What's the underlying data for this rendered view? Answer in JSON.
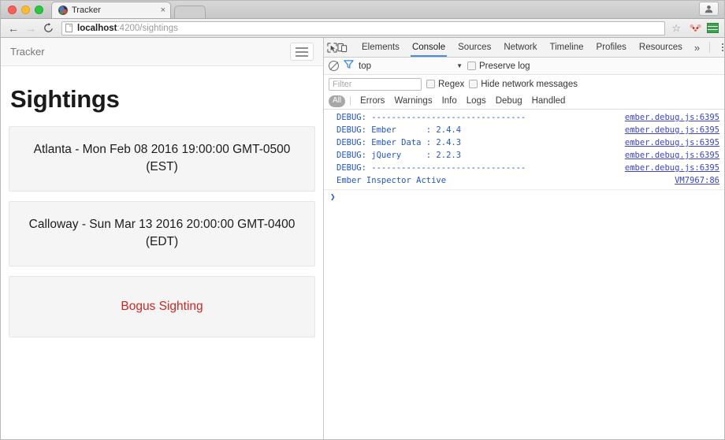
{
  "browser": {
    "traffic_lights": [
      "close",
      "minimize",
      "zoom"
    ],
    "tab": {
      "title": "Tracker",
      "close_label": "×",
      "favicon": "globe-favicon"
    },
    "toolbar": {
      "back_label": "←",
      "forward_label": "→",
      "reload_label": "↻",
      "url_host": "localhost",
      "url_rest": ":4200/sightings",
      "url_full": "localhost:4200/sightings",
      "bookmark_label": "☆",
      "profile_icon": "person-icon",
      "extension_icon": "ember-extension-icon",
      "menu_extension_icon": "green-lines-extension-icon"
    }
  },
  "app": {
    "brand": "Tracker",
    "nav_toggle": "hamburger-menu",
    "page_title": "Sightings",
    "sightings": [
      {
        "text": "Atlanta - Mon Feb 08 2016 19:00:00 GMT-0500 (EST)",
        "bogus": false
      },
      {
        "text": "Calloway - Sun Mar 13 2016 20:00:00 GMT-0400 (EDT)",
        "bogus": false
      },
      {
        "text": "Bogus Sighting",
        "bogus": true
      }
    ],
    "bogus_color": "#cf2620"
  },
  "devtools": {
    "toolbar_icons": [
      "inspect-element-icon",
      "device-toolbar-icon"
    ],
    "tabs": [
      {
        "label": "Elements",
        "active": false
      },
      {
        "label": "Console",
        "active": true
      },
      {
        "label": "Sources",
        "active": false
      },
      {
        "label": "Network",
        "active": false
      },
      {
        "label": "Timeline",
        "active": false
      },
      {
        "label": "Profiles",
        "active": false
      },
      {
        "label": "Resources",
        "active": false
      }
    ],
    "more_tabs_label": "»",
    "menu_label": "kebab-menu",
    "close_label": "✕",
    "accent_color": "#4a90d9",
    "console_toolbar": {
      "clear_label": "clear-console",
      "filter_icon": "funnel-icon",
      "context_value": "top",
      "context_caret": "▼",
      "preserve_log_label": "Preserve log",
      "preserve_log_checked": false
    },
    "filter_row": {
      "filter_placeholder": "Filter",
      "filter_value": "",
      "regex_label": "Regex",
      "regex_checked": false,
      "hide_network_label": "Hide network messages",
      "hide_network_checked": false
    },
    "levels": {
      "selected": "All",
      "items": [
        "Errors",
        "Warnings",
        "Info",
        "Logs",
        "Debug",
        "Handled"
      ]
    },
    "console_messages": [
      {
        "message": "DEBUG: -------------------------------",
        "source": "ember.debug.js:6395"
      },
      {
        "message": "DEBUG: Ember      : 2.4.4",
        "source": "ember.debug.js:6395"
      },
      {
        "message": "DEBUG: Ember Data : 2.4.3",
        "source": "ember.debug.js:6395"
      },
      {
        "message": "DEBUG: jQuery     : 2.2.3",
        "source": "ember.debug.js:6395"
      },
      {
        "message": "DEBUG: -------------------------------",
        "source": "ember.debug.js:6395"
      },
      {
        "message": "Ember Inspector Active",
        "source": "VM7967:86"
      }
    ],
    "prompt_caret": "❯"
  }
}
